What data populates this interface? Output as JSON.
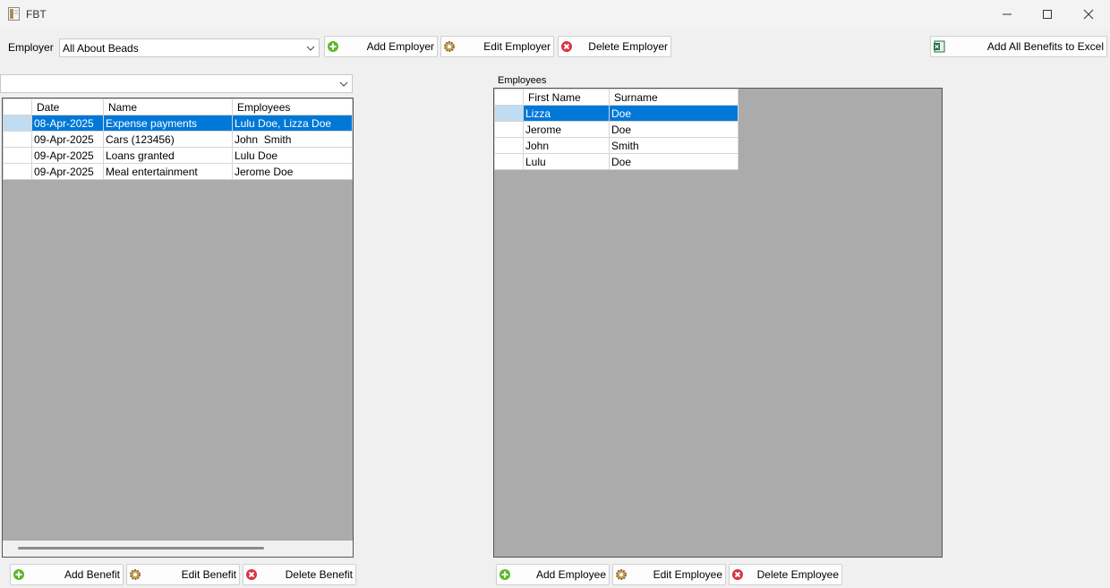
{
  "window": {
    "title": "FBT"
  },
  "employer": {
    "label": "Employer",
    "selected": "All About Beads",
    "add_label": "Add Employer",
    "edit_label": "Edit Employer",
    "delete_label": "Delete Employer",
    "excel_label": "Add All Benefits to Excel"
  },
  "benefits": {
    "filter_value": "",
    "columns": [
      "Date",
      "Name",
      "Employees"
    ],
    "rows": [
      {
        "date": "08-Apr-2025",
        "name": "Expense payments",
        "employees": "Lulu Doe, Lizza Doe",
        "selected": true
      },
      {
        "date": "09-Apr-2025",
        "name": "Cars (123456)",
        "employees": "John  Smith",
        "selected": false
      },
      {
        "date": "09-Apr-2025",
        "name": "Loans granted",
        "employees": "Lulu Doe",
        "selected": false
      },
      {
        "date": "09-Apr-2025",
        "name": "Meal entertainment",
        "employees": "Jerome Doe",
        "selected": false
      }
    ],
    "add_label": "Add Benefit",
    "edit_label": "Edit Benefit",
    "delete_label": "Delete Benefit"
  },
  "employees": {
    "group_label": "Employees",
    "columns": [
      "First Name",
      "Surname"
    ],
    "rows": [
      {
        "first": "Lizza",
        "surname": "Doe",
        "selected": true
      },
      {
        "first": "Jerome",
        "surname": "Doe",
        "selected": false
      },
      {
        "first": "John",
        "surname": "Smith",
        "selected": false
      },
      {
        "first": "Lulu",
        "surname": "Doe",
        "selected": false
      }
    ],
    "add_label": "Add Employee",
    "edit_label": "Edit Employee",
    "delete_label": "Delete Employee"
  },
  "icons": {
    "add": "plus-circle-icon",
    "edit": "gear-icon",
    "delete": "x-circle-icon",
    "excel": "excel-icon"
  },
  "colors": {
    "selection": "#0078d7",
    "add": "#5cb82c",
    "delete": "#d9333f",
    "excel": "#1d6f42"
  }
}
